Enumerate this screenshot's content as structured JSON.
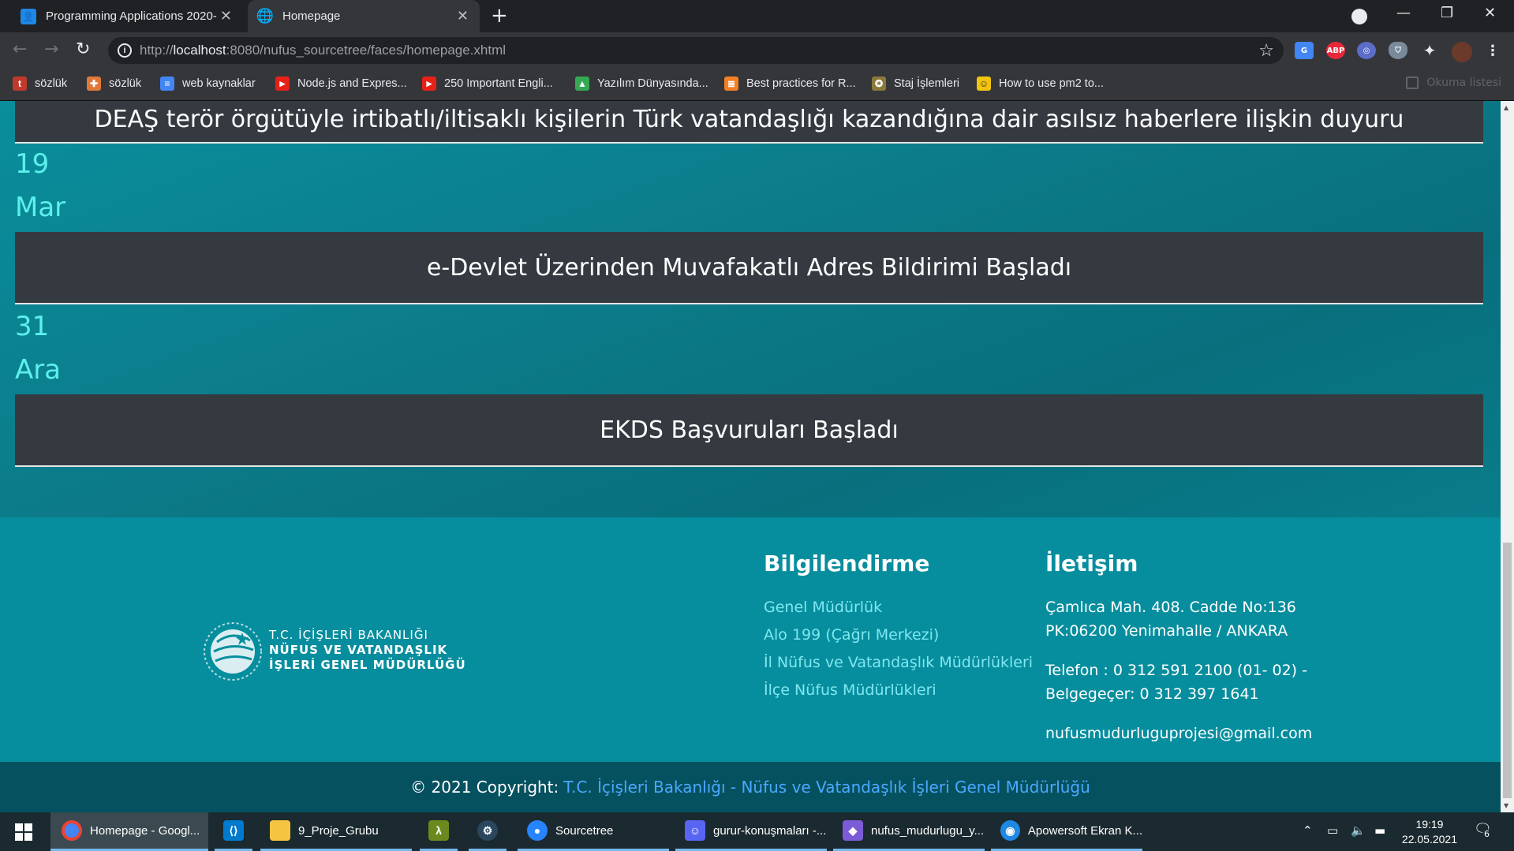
{
  "browser": {
    "tabs": [
      {
        "title": "Programming Applications 2020-",
        "icon": "classroom-icon",
        "active": false
      },
      {
        "title": "Homepage",
        "icon": "globe-icon",
        "active": true
      }
    ],
    "url_prefix": "http://",
    "url_host": "localhost",
    "url_path": ":8080/nufus_sourcetree/faces/homepage.xhtml",
    "extensions": [
      "google-translate-icon",
      "adblock-icon",
      "extension-icon",
      "shield-icon",
      "puzzle-icon",
      "profile-avatar"
    ],
    "extension_labels": {
      "adblock": "ABP"
    },
    "bookmarks": [
      {
        "label": "sözlük",
        "icon": "tureng-icon",
        "color": "#c0392b",
        "glyph": "t"
      },
      {
        "label": "sözlük",
        "icon": "cambridge-icon",
        "color": "#e0783a",
        "glyph": "✚"
      },
      {
        "label": "web kaynaklar",
        "icon": "docs-icon",
        "color": "#4285f4",
        "glyph": "≡"
      },
      {
        "label": "Node.js and Expres...",
        "icon": "youtube-icon",
        "color": "#e62117",
        "glyph": "▶"
      },
      {
        "label": "250 Important Engli...",
        "icon": "youtube-icon",
        "color": "#e62117",
        "glyph": "▶"
      },
      {
        "label": "Yazılım Dünyasında...",
        "icon": "drive-icon",
        "color": "#34a853",
        "glyph": "▲"
      },
      {
        "label": "Best practices for R...",
        "icon": "stackoverflow-icon",
        "color": "#f48024",
        "glyph": "≣"
      },
      {
        "label": "Staj İşlemleri",
        "icon": "seal-icon",
        "color": "#8a7a3a",
        "glyph": "✪"
      },
      {
        "label": "How to use pm2 to...",
        "icon": "emoji-icon",
        "color": "#f1c40f",
        "glyph": "☺"
      }
    ],
    "reading_list": "Okuma listesi"
  },
  "news": {
    "top_title": "DEAŞ terör örgütüyle irtibatlı/iltisaklı kişilerin Türk vatandaşlığı kazandığına dair asılsız haberlere ilişkin duyuru",
    "items": [
      {
        "day": "19",
        "month": "Mar",
        "title": "e-Devlet Üzerinden Muvafakatlı Adres Bildirimi Başladı"
      },
      {
        "day": "31",
        "month": "Ara",
        "title": "EKDS Başvuruları Başladı"
      }
    ]
  },
  "footer": {
    "logo": {
      "line1": "T.C. İÇİŞLERİ BAKANLIĞI",
      "line2": "NÜFUS VE VATANDAŞLIK",
      "line3": "İŞLERİ GENEL MÜDÜRLÜĞÜ"
    },
    "info_heading": "Bilgilendirme",
    "info_links": [
      "Genel Müdürlük",
      "Alo 199 (Çağrı Merkezi)",
      "İl Nüfus ve Vatandaşlık Müdürlükleri",
      "İlçe Nüfus Müdürlükleri"
    ],
    "contact_heading": "İletişim",
    "address_line1": "Çamlıca Mah. 408. Cadde No:136",
    "address_line2": "PK:06200 Yenimahalle / ANKARA",
    "phone": "Telefon : 0 312 591 2100 (01- 02) -",
    "fax": "Belgegeçer: 0 312 397 1641",
    "email": "nufusmudurluguprojesi@gmail.com",
    "copyright": "© 2021 Copyright:",
    "copyright_link": "T.C. İçişleri Bakanlığı - Nüfus ve Vatandaşlık İşleri Genel Müdürlüğü"
  },
  "taskbar": {
    "items": [
      {
        "label": "Homepage - Googl...",
        "icon": "chrome-icon",
        "color": "#4285f4"
      },
      {
        "label": "",
        "icon": "vscode-icon",
        "color": "#007acc"
      },
      {
        "label": "9_Proje_Grubu",
        "icon": "folder-icon",
        "color": "#f5c542"
      },
      {
        "label": "",
        "icon": "lambda-icon",
        "color": "#6a8a1f"
      },
      {
        "label": "",
        "icon": "steam-icon",
        "color": "#1b2838"
      },
      {
        "label": "Sourcetree",
        "icon": "sourcetree-icon",
        "color": "#2684ff"
      },
      {
        "label": "gurur-konuşmaları -...",
        "icon": "discord-icon",
        "color": "#5865f2"
      },
      {
        "label": "nufus_mudurlugu_y...",
        "icon": "cube-icon",
        "color": "#7b5cd6"
      },
      {
        "label": "Apowersoft Ekran K...",
        "icon": "apowersoft-icon",
        "color": "#1e88e5"
      }
    ],
    "time": "19:19",
    "date": "22.05.2021",
    "notification_count": "6"
  }
}
